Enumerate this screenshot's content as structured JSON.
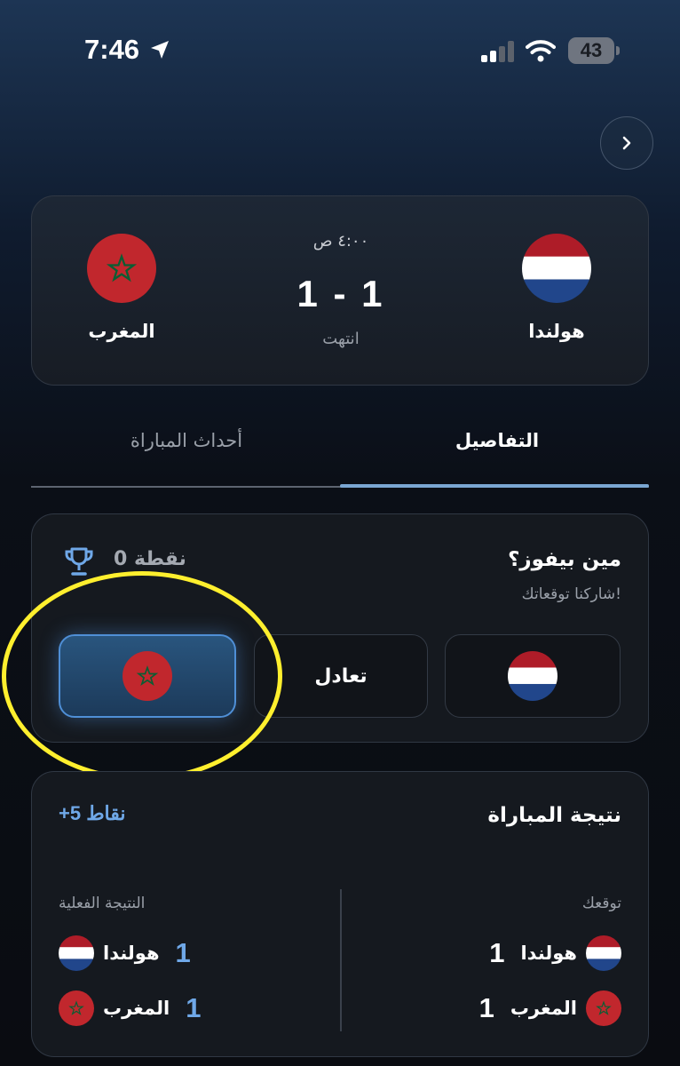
{
  "status_bar": {
    "time": "7:46",
    "battery": "43"
  },
  "match": {
    "home_team": "هولندا",
    "away_team": "المغرب",
    "kickoff_time": "٤:٠٠ ص",
    "score": "1 - 1",
    "status": "انتهت"
  },
  "tabs": [
    {
      "label": "التفاصيل",
      "active": true
    },
    {
      "label": "أحداث المباراة",
      "active": false
    }
  ],
  "prediction": {
    "title": "مين بيفوز؟",
    "subtitle": "شاركنا توقعاتك!",
    "points": "0 نقطة",
    "options": [
      {
        "label": "هولندا",
        "icon": "netherlands-flag-icon"
      },
      {
        "label": "تعادل"
      },
      {
        "label": "المغرب",
        "icon": "morocco-flag-icon",
        "selected": true
      }
    ]
  },
  "result": {
    "title": "نتيجة المباراة",
    "bonus": "+5 نقاط",
    "your_prediction": {
      "label": "توقعك",
      "rows": [
        {
          "team": "هولندا",
          "score": "1"
        },
        {
          "team": "المغرب",
          "score": "1"
        }
      ]
    },
    "actual_result": {
      "label": "النتيجة الفعلية",
      "rows": [
        {
          "team": "هولندا",
          "score": "1"
        },
        {
          "team": "المغرب",
          "score": "1"
        }
      ]
    }
  },
  "colors": {
    "accent_blue": "#6fa8e8",
    "selected_border": "#4f8fd6",
    "highlight_yellow": "#ffef2e",
    "morocco_red": "#c1272d",
    "morocco_star": "#006233",
    "nl_red": "#ae1c28",
    "nl_blue": "#21468b"
  }
}
